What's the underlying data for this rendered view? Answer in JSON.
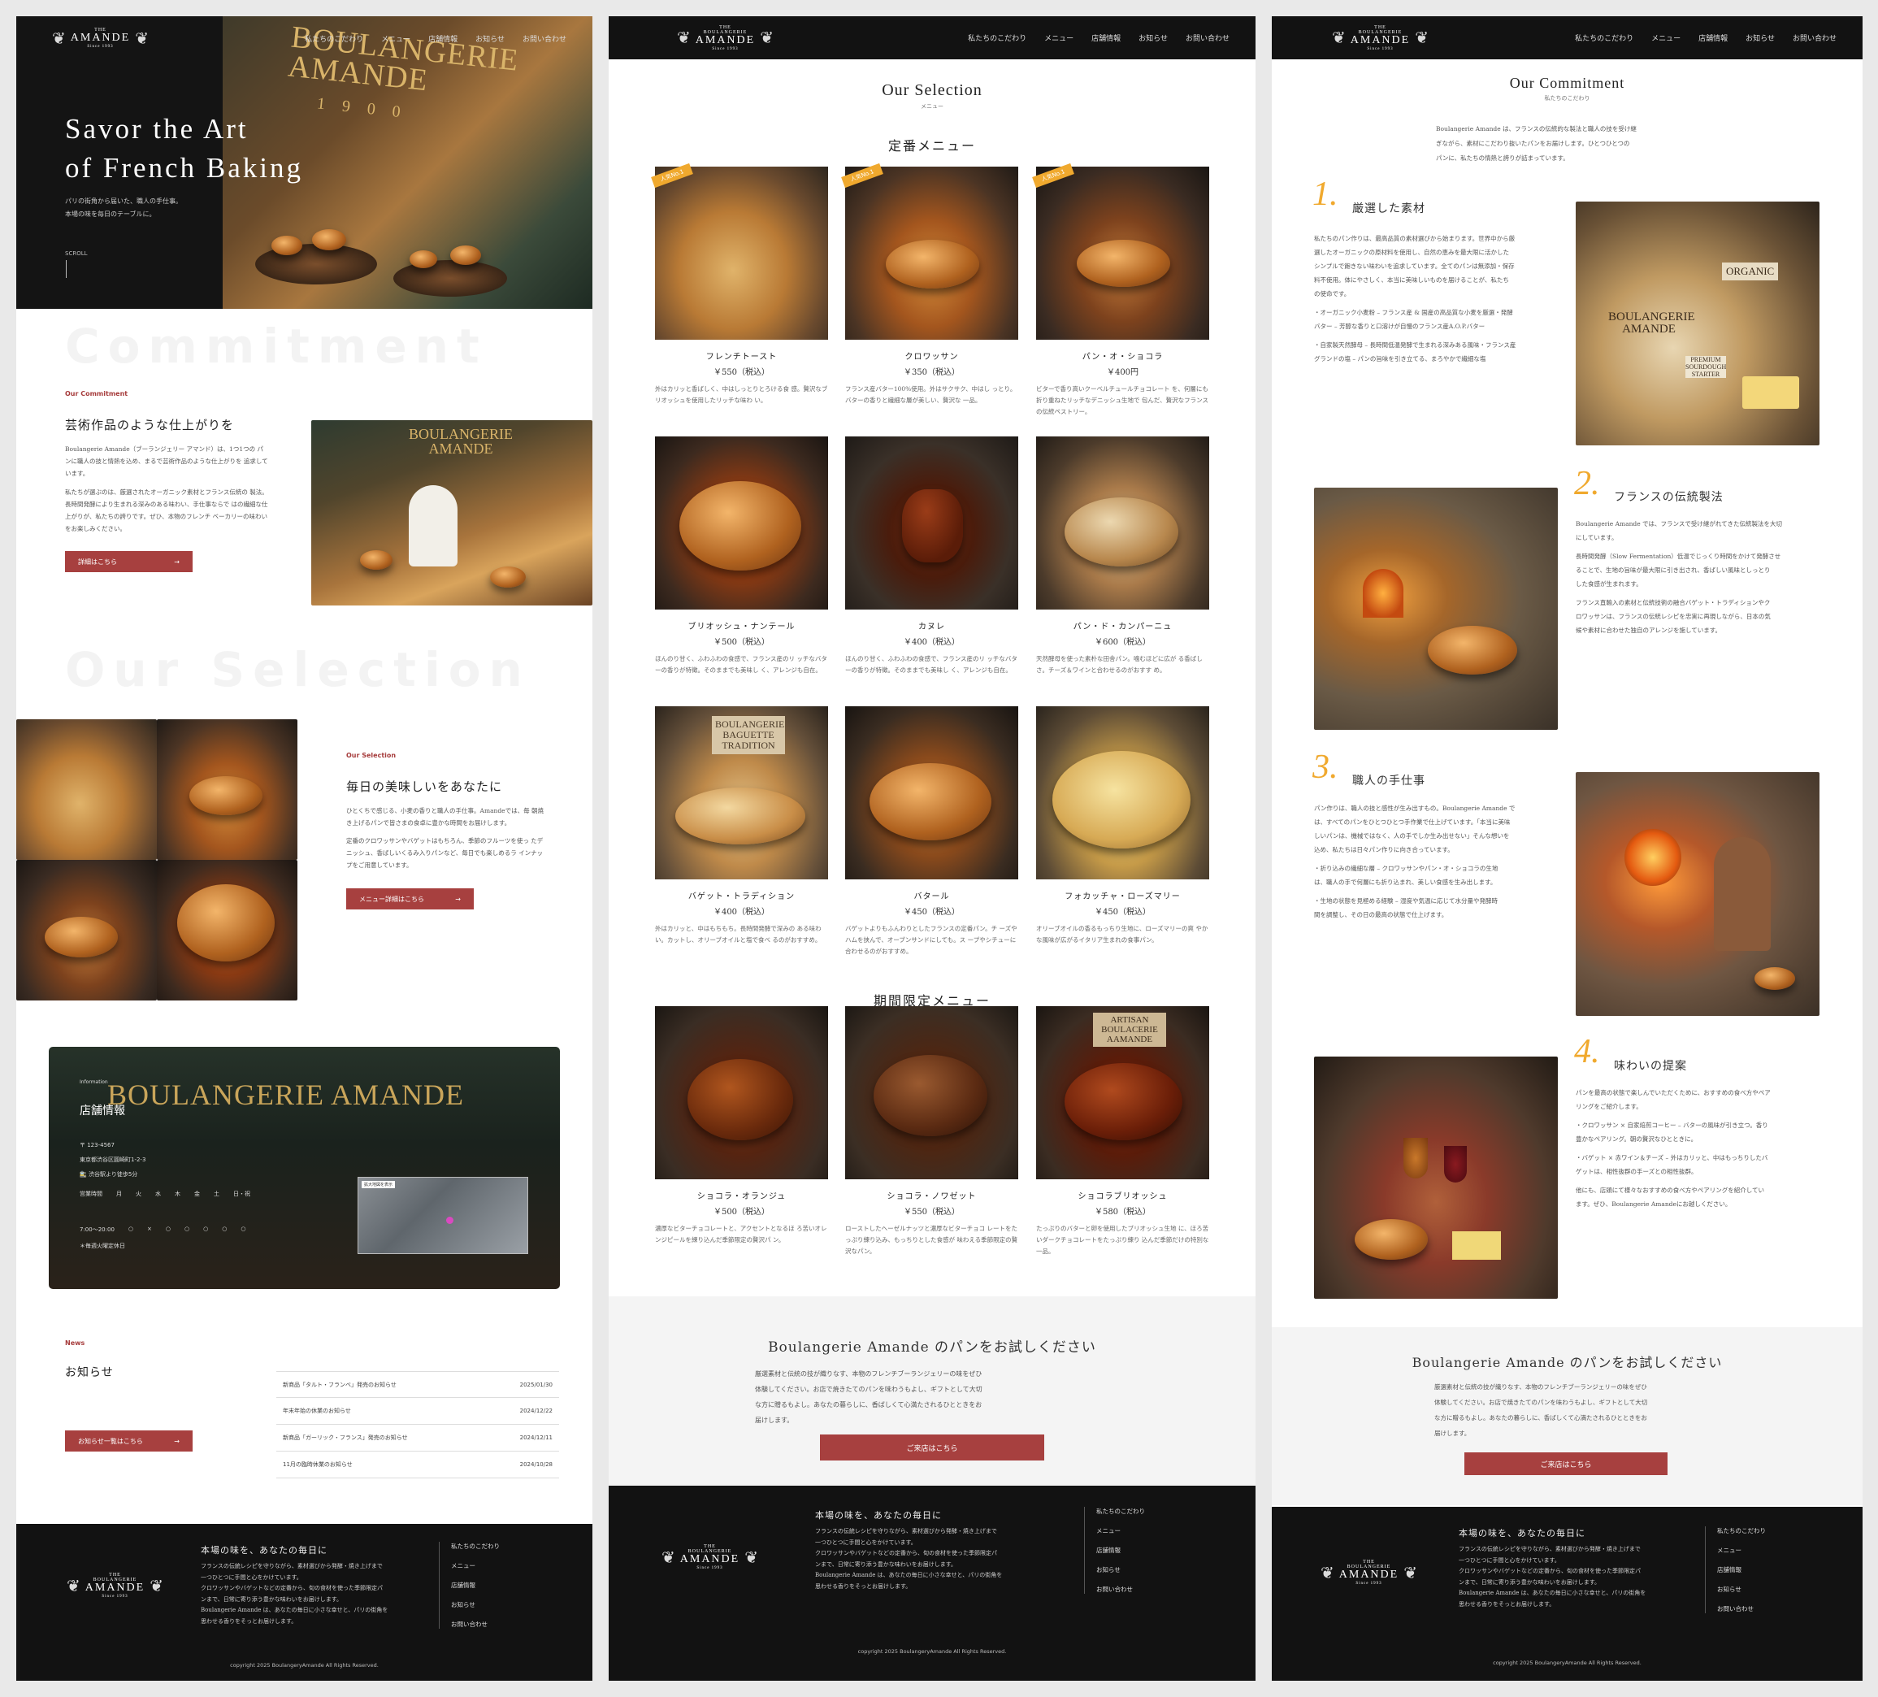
{
  "brand": {
    "the": "THE",
    "name_top": "BOULANGERIE",
    "name": "AMANDE",
    "since": "Since 1993"
  },
  "nav": [
    "私たちのこだわり",
    "メニュー",
    "店舗情報",
    "お知らせ",
    "お問い合わせ"
  ],
  "home": {
    "hero": {
      "sign_line1": "BOULANGERIE",
      "sign_line2": "AMANDE",
      "sign_line3": "1 9 0 0",
      "title_line1": "Savor the Art",
      "title_line2": "of French Baking",
      "subtitle_line1": "パリの街角から届いた、職人の手仕事。",
      "subtitle_line2": "本場の味を毎日のテーブルに。",
      "scroll": "SCROLL"
    },
    "commitment": {
      "ghost": "Commitment",
      "eyebrow": "Our Commitment",
      "heading": "芸術作品のような仕上がりを",
      "body1": "Boulangerie Amande（ブーランジェリー アマンド）は、1つ1つの パンに職人の技と情熱を込め、まるで芸術作品のような仕上がりを 追求しています。",
      "body2": "私たちが選ぶのは、厳選されたオーガニック素材とフランス伝統の 製法。長時間発酵により生まれる深みのある味わい、手仕事ならで はの繊細な仕上がりが、私たちの誇りです。ぜひ、本物のフレンチ ベーカリーの味わいをお楽しみください。",
      "button": "詳細はこちら",
      "img_sign1": "BOULANGERIE",
      "img_sign2": "AMANDE"
    },
    "selection": {
      "ghost": "Our Selection",
      "eyebrow": "Our Selection",
      "heading": "毎日の美味しいをあなたに",
      "body1": "ひとくちで感じる、小麦の香りと職人の手仕事。Amandeでは、毎 朝焼き上げるパンで皆さまの食卓に豊かな時間をお届けします。",
      "body2": "定番のクロワッサンやバゲットはもちろん、季節のフルーツを使っ たデニッシュ、香ばしいくるみ入りパンなど、毎日でも楽しめるラ インナップをご用意しています。",
      "button": "メニュー詳細はこちら"
    },
    "info": {
      "sign": "BOULANGERIE AMANDE",
      "eyebrow": "Information",
      "heading": "店舗情報",
      "zip": "〒 123-4567",
      "address": "東京都渋谷区圓崎町1-2-3",
      "access": "渋谷駅より徒歩5分",
      "hours_label": "営業時間",
      "days": [
        "月",
        "火",
        "水",
        "木",
        "金",
        "土",
        "日・祝"
      ],
      "hours": "7:00〜20:00",
      "marks": [
        "○",
        "×",
        "○",
        "○",
        "○",
        "○",
        "○"
      ],
      "closed": "＊毎週火曜定休日",
      "map_tag": "拡大地図を表示"
    },
    "news": {
      "eyebrow": "News",
      "heading": "お知らせ",
      "button": "お知らせ一覧はこちら",
      "items": [
        {
          "title": "新商品「タルト・フランベ」発売のお知らせ",
          "date": "2025/01/30"
        },
        {
          "title": "年末年始の休業のお知らせ",
          "date": "2024/12/22"
        },
        {
          "title": "新商品「ガーリック・フランス」発売のお知らせ",
          "date": "2024/12/11"
        },
        {
          "title": "11月の臨時休業のお知らせ",
          "date": "2024/10/28"
        }
      ]
    }
  },
  "footer": {
    "title": "本場の味を、あなたの毎日に",
    "body": [
      "フランスの伝統レシピを守りながら、素材選びから発酵・焼き上げまで",
      "一つひとつに手間と心をかけています。",
      "クロワッサンやバゲットなどの定番から、旬の食材を使った季節限定パ",
      "ンまで、日常に寄り添う豊かな味わいをお届けします。",
      "Boulangerie Amande は、あなたの毎日に小さな幸せと、パリの街角を",
      "思わせる香りをそっとお届けします。"
    ],
    "links": [
      "私たちのこだわり",
      "メニュー",
      "店舗情報",
      "お知らせ",
      "お問い合わせ"
    ],
    "copyright": "copyright 2025 BoulangeryAmande All Rights Reserved."
  },
  "menu_page": {
    "title": "Our Selection",
    "subtitle": "メニュー",
    "regular_heading": "定番メニュー",
    "limited_heading": "期間限定メニュー",
    "badge": "人気No.1",
    "regular": [
      {
        "name": "フレンチトースト",
        "price": "￥550（税込）",
        "desc": "外はカリッと香ばしく、中はしっとりとろける食 感。贅沢なブリオッシュを使用したリッチな味わ い。"
      },
      {
        "name": "クロワッサン",
        "price": "￥350（税込）",
        "desc": "フランス産バター100%使用。外はサクサク、中はし っとり。バターの香りと繊細な層が美しい、贅沢な 一品。"
      },
      {
        "name": "パン・オ・ショコラ",
        "price": "￥400円",
        "desc": "ビターで香り高いクーベルチュールチョコレート を、何層にも折り重ねたリッチなデニッシュ生地で 包んだ、贅沢なフランスの伝統ペストリー。"
      },
      {
        "name": "ブリオッシュ・ナンテール",
        "price": "￥500（税込）",
        "desc": "ほんのり甘く、ふわふわの食感で、フランス産のリ ッチなバターの香りが特徴。そのままでも美味し く、アレンジも自在。"
      },
      {
        "name": "カヌレ",
        "price": "￥400（税込）",
        "desc": "ほんのり甘く、ふわふわの食感で、フランス産のリ ッチなバターの香りが特徴。そのままでも美味し く、アレンジも自在。"
      },
      {
        "name": "パン・ド・カンパーニュ",
        "price": "￥600（税込）",
        "desc": "天然酵母を使った素朴な田舎パン。噛むほどに広が る香ばしさ。チーズ＆ワインと合わせるのがおすす め。"
      },
      {
        "name": "バゲット・トラディション",
        "price": "￥400（税込）",
        "desc": "外はカリッと、中はもちもち。長時間発酵で深みの ある味わい。カットし、オリーブオイルと塩で食べ るのがおすすめ。"
      },
      {
        "name": "バタール",
        "price": "￥450（税込）",
        "desc": "バゲットよりもふんわりとしたフランスの定番パン。チ ーズやハムを挟んで、オーブンサンドにしても。ス ープやシチューに合わせるのがおすすめ。"
      },
      {
        "name": "フォカッチャ・ローズマリー",
        "price": "￥450（税込）",
        "desc": "オリーブオイルの香るもっちり生地に、ローズマリーの爽 やかな風味が広がるイタリア生まれの食事パン。"
      }
    ],
    "limited": [
      {
        "name": "ショコラ・オランジュ",
        "price": "￥500（税込）",
        "desc": "濃厚なビターチョコレートと、アクセントとなるほ ろ苦いオレンジピールを練り込んだ季節限定の贅沢パ ン。"
      },
      {
        "name": "ショコラ・ノワゼット",
        "price": "￥550（税込）",
        "desc": "ローストしたヘーゼルナッツと濃厚なビターチョコ レートをたっぷり練り込み、もっちりとした食感が 味わえる季節限定の贅沢なパン。"
      },
      {
        "name": "ショコラブリオッシュ",
        "price": "￥580（税込）",
        "desc": "たっぷりのバターと卵を使用したブリオッシュ生地 に、ほろ苦いダークチョコレートをたっぷり練り 込んだ季節だけの特別な一品。"
      }
    ],
    "img_sign_baguette": "BOULANGERIE BAGUETTE TRADITION",
    "img_sign_brioche": "BOULANGERIE AMANDE",
    "img_sign_artisan": "ARTISAN BOULACERIE AAMANDE"
  },
  "cta": {
    "title": "Boulangerie Amande のパンをお試しください",
    "body": [
      "厳選素材と伝統の技が織りなす、本物のフレンチブーランジェリーの味をぜひ",
      "体験してください。お店で焼きたてのパンを味わうもよし、ギフトとして大切",
      "な方に贈るもよし。あなたの暮らしに、香ばしくて心満たされるひとときをお",
      "届けします。"
    ],
    "button": "ご来店はこちら"
  },
  "commitment_page": {
    "title": "Our Commitment",
    "subtitle": "私たちのこだわり",
    "intro": [
      "Boulangerie Amande は、フランスの伝統的な製法と職人の技を受け継",
      "ぎながら、素材にこだわり抜いたパンをお届けします。ひとつひとつの",
      "パンに、私たちの情熱と誇りが詰まっています。"
    ],
    "items": [
      {
        "num": "1.",
        "title": "厳選した素材",
        "body": [
          "私たちのパン作りは、最高品質の素材選びから始まります。世界中から厳",
          "選したオーガニックの原材料を使用し、自然の恵みを最大限に活かした",
          "シンプルで飽きない味わいを追求しています。全てのパンは無添加・保存",
          "料不使用。体にやさしく、本当に美味しいものを届けることが、私たち",
          "の使命です。",
          "",
          "・オーガニック小麦粉 – フランス産 & 国産の高品質な小麦を厳選・発酵",
          "バター – 芳醇な香りと口溶けが自慢のフランス産A.O.P.バター",
          "",
          "・自家製天然酵母 – 長時間低温発酵で生まれる深みある風味・フランス産",
          "グランドの塩 – パンの旨味を引き立てる、まろやかで繊細な塩"
        ]
      },
      {
        "num": "2.",
        "title": "フランスの伝統製法",
        "body": [
          "Boulangerie Amande では、フランスで受け継がれてきた伝統製法を大切",
          "にしています。",
          "",
          "長時間発酵（Slow Fermentation）低温でじっくり時間をかけて発酵させ",
          "ることで、生地の旨味が最大限に引き出され、香ばしい風味としっとり",
          "した食感が生まれます。",
          "",
          "フランス直輸入の素材と伝統技術の融合バゲット・トラディションやク",
          "ロワッサンは、フランスの伝統レシピを忠実に再現しながら、日本の気",
          "候や素材に合わせた独自のアレンジを施しています。"
        ]
      },
      {
        "num": "3.",
        "title": "職人の手仕事",
        "body": [
          "パン作りは、職人の技と感性が生み出すもの。Boulangerie Amande で",
          "は、すべてのパンをひとつひとつ手作業で仕上げています。「本当に美味",
          "しいパンは、機械ではなく、人の手でしか生み出せない」そんな想いを",
          "込め、私たちは日々パン作りに向き合っています。",
          "",
          "・折り込みの繊細な層 – クロワッサンやパン・オ・ショコラの生地",
          "は、職人の手で何層にも折り込まれ、美しい食感を生み出します。",
          "",
          "・生地の状態を見極める経験 – 湿度や気温に応じて水分量や発酵時",
          "間を調整し、その日の最高の状態で仕上げます。"
        ]
      },
      {
        "num": "4.",
        "title": "味わいの提案",
        "body": [
          "パンを最高の状態で楽しんでいただくために、おすすめの食べ方やペア",
          "リングをご紹介します。",
          "",
          "・クロワッサン × 自家焙煎コーヒー – バターの風味が引き立つ。香り",
          "豊かなペアリング。朝の贅沢なひとときに。",
          "",
          "・バゲット × 赤ワイン＆チーズ – 外はカリッと、中はもっちりしたバ",
          "ゲットは、相性抜群の手ーズとの相性抜群。",
          "",
          "他にも、店頭にて様々なおすすめの食べ方やペアリングを紹介してい",
          "ます。ぜひ、Boulangerie Amandeにお越しください。"
        ]
      }
    ],
    "img_sign1": "BOULANGERIE AMANDE",
    "img_sign2": "ORGANIC",
    "img_sign3": "PREMIUM SOURDOUGH STARTER"
  }
}
